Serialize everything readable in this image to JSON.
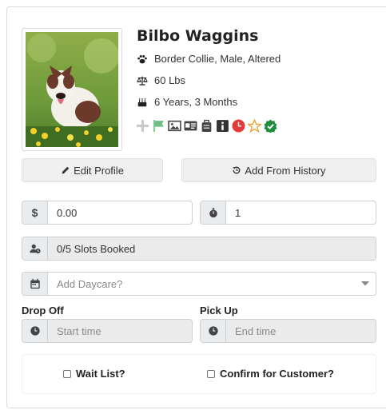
{
  "pet": {
    "name": "Bilbo Waggins",
    "breed_line": "Border Collie, Male, Altered",
    "weight_line": "60 Lbs",
    "age_line": "6 Years, 3 Months"
  },
  "icons": {
    "breed": "paw-icon",
    "weight": "balance-scale-icon",
    "age": "birthday-cake-icon",
    "badges": [
      "plus-icon",
      "flag-icon",
      "image-icon",
      "id-card-icon",
      "suitcase-icon",
      "info-icon",
      "clock-icon",
      "star-icon",
      "check-shield-icon"
    ]
  },
  "buttons": {
    "edit_profile": "Edit Profile",
    "add_from_history": "Add From History"
  },
  "price": {
    "addon": "$",
    "value": "0.00"
  },
  "quantity": {
    "value": "1"
  },
  "slots": {
    "value": "0/5 Slots Booked"
  },
  "daycare": {
    "placeholder": "Add Daycare?"
  },
  "drop_off": {
    "label": "Drop Off",
    "placeholder": "Start time"
  },
  "pick_up": {
    "label": "Pick Up",
    "placeholder": "End time"
  },
  "checkboxes": {
    "wait_list": "Wait List?",
    "confirm_customer": "Confirm for Customer?"
  },
  "colors": {
    "badge_green": "#6dbf86",
    "badge_red": "#e03a3a",
    "badge_orange": "#f0a030",
    "badge_darkgreen": "#1e8e3e",
    "addon_bg": "#e9ecef",
    "button_bg": "#efefef"
  }
}
